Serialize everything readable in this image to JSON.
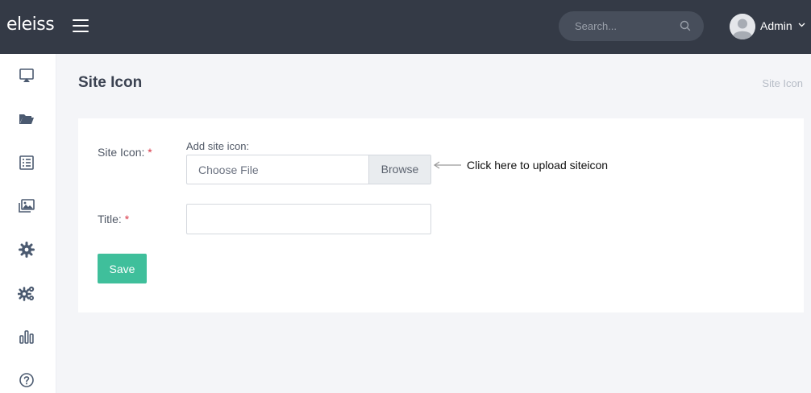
{
  "header": {
    "logo": "eleiss",
    "search_placeholder": "Search...",
    "user_name": "Admin"
  },
  "sidebar": {
    "icons": [
      "presentation-icon",
      "folder-open-icon",
      "list-check-icon",
      "images-icon",
      "gear-icon",
      "gears-icon",
      "bar-chart-icon",
      "help-circle-icon"
    ]
  },
  "page": {
    "title": "Site Icon",
    "breadcrumb": "Site Icon"
  },
  "form": {
    "site_icon_label": "Site Icon:",
    "required_marker": "*",
    "add_site_icon_label": "Add site icon:",
    "file_placeholder": "Choose File",
    "browse_label": "Browse",
    "upload_hint": "Click here to upload siteicon",
    "title_label": "Title:",
    "title_value": "",
    "save_label": "Save"
  },
  "colors": {
    "topbar": "#343a46",
    "accent": "#3fbf9b",
    "required": "#d93848"
  }
}
